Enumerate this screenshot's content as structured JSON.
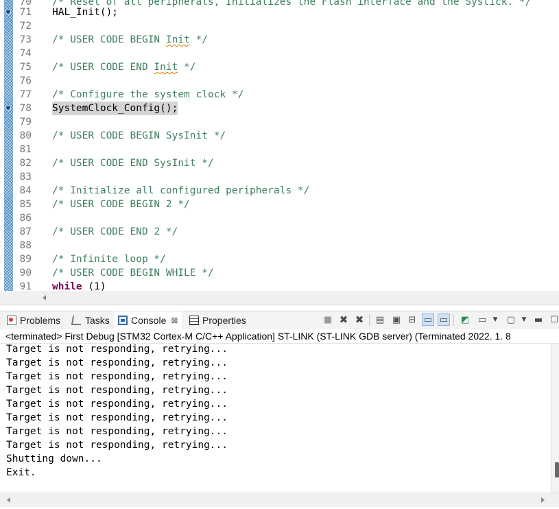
{
  "editor": {
    "partial_top_line": {
      "number": "70",
      "text": "/* Reset of all peripherals, Initializes the Flash interface and the Systick. */"
    },
    "lines": [
      {
        "number": "71",
        "text": "HAL_Init();"
      },
      {
        "number": "72",
        "text": ""
      },
      {
        "number": "73",
        "text": "/* USER CODE BEGIN Init */"
      },
      {
        "number": "74",
        "text": ""
      },
      {
        "number": "75",
        "text": "/* USER CODE END Init */"
      },
      {
        "number": "76",
        "text": ""
      },
      {
        "number": "77",
        "text": "/* Configure the system clock */"
      },
      {
        "number": "78",
        "text": "SystemClock_Config();"
      },
      {
        "number": "79",
        "text": ""
      },
      {
        "number": "80",
        "text": "/* USER CODE BEGIN SysInit */"
      },
      {
        "number": "81",
        "text": ""
      },
      {
        "number": "82",
        "text": "/* USER CODE END SysInit */"
      },
      {
        "number": "83",
        "text": ""
      },
      {
        "number": "84",
        "text": "/* Initialize all configured peripherals */"
      },
      {
        "number": "85",
        "text": "/* USER CODE BEGIN 2 */"
      },
      {
        "number": "86",
        "text": ""
      },
      {
        "number": "87",
        "text": "/* USER CODE END 2 */"
      },
      {
        "number": "88",
        "text": ""
      },
      {
        "number": "89",
        "text": "/* Infinite loop */"
      },
      {
        "number": "90",
        "text": "/* USER CODE BEGIN WHILE */"
      },
      {
        "number": "91",
        "text": "while (1)"
      }
    ],
    "line73_parts": {
      "pre": "/* USER CODE BEGIN ",
      "word": "Init",
      "post": " */"
    },
    "line75_parts": {
      "pre": "/* USER CODE END ",
      "word": "Init",
      "post": " */"
    },
    "line91_parts": {
      "kw": "while",
      "rest": " (1)"
    }
  },
  "views": {
    "tabs": [
      {
        "label": "Problems",
        "icon": "problems-icon"
      },
      {
        "label": "Tasks",
        "icon": "tasks-icon"
      },
      {
        "label": "Console",
        "icon": "console-icon",
        "active": true,
        "close": "⊠"
      },
      {
        "label": "Properties",
        "icon": "properties-icon"
      }
    ],
    "toolbar_icons": [
      "terminate-icon",
      "remove-launch-icon",
      "remove-all-terminated-icon",
      "scroll-lock-icon",
      "word-wrap-icon",
      "show-on-output-icon",
      "show-on-error-icon",
      "pin-console-icon",
      "display-selected-console-icon",
      "open-console-icon",
      "minimize-icon",
      "maximize-icon"
    ]
  },
  "console": {
    "header": "<terminated> First Debug [STM32 Cortex-M C/C++ Application] ST-LINK (ST-LINK GDB server) (Terminated 2022. 1. 8",
    "lines": [
      "Target is not responding, retrying...",
      "Target is not responding, retrying...",
      "Target is not responding, retrying...",
      "Target is not responding, retrying...",
      "Target is not responding, retrying...",
      "Target is not responding, retrying...",
      "Target is not responding, retrying...",
      "Target is not responding, retrying...",
      "Shutting down...",
      "Exit."
    ]
  },
  "colors": {
    "comment": "#3f7f5f",
    "keyword": "#7f0055",
    "line_number": "#787878",
    "active_tab": "#ffffff",
    "toolbar_pressed": "#cfe2f7"
  }
}
